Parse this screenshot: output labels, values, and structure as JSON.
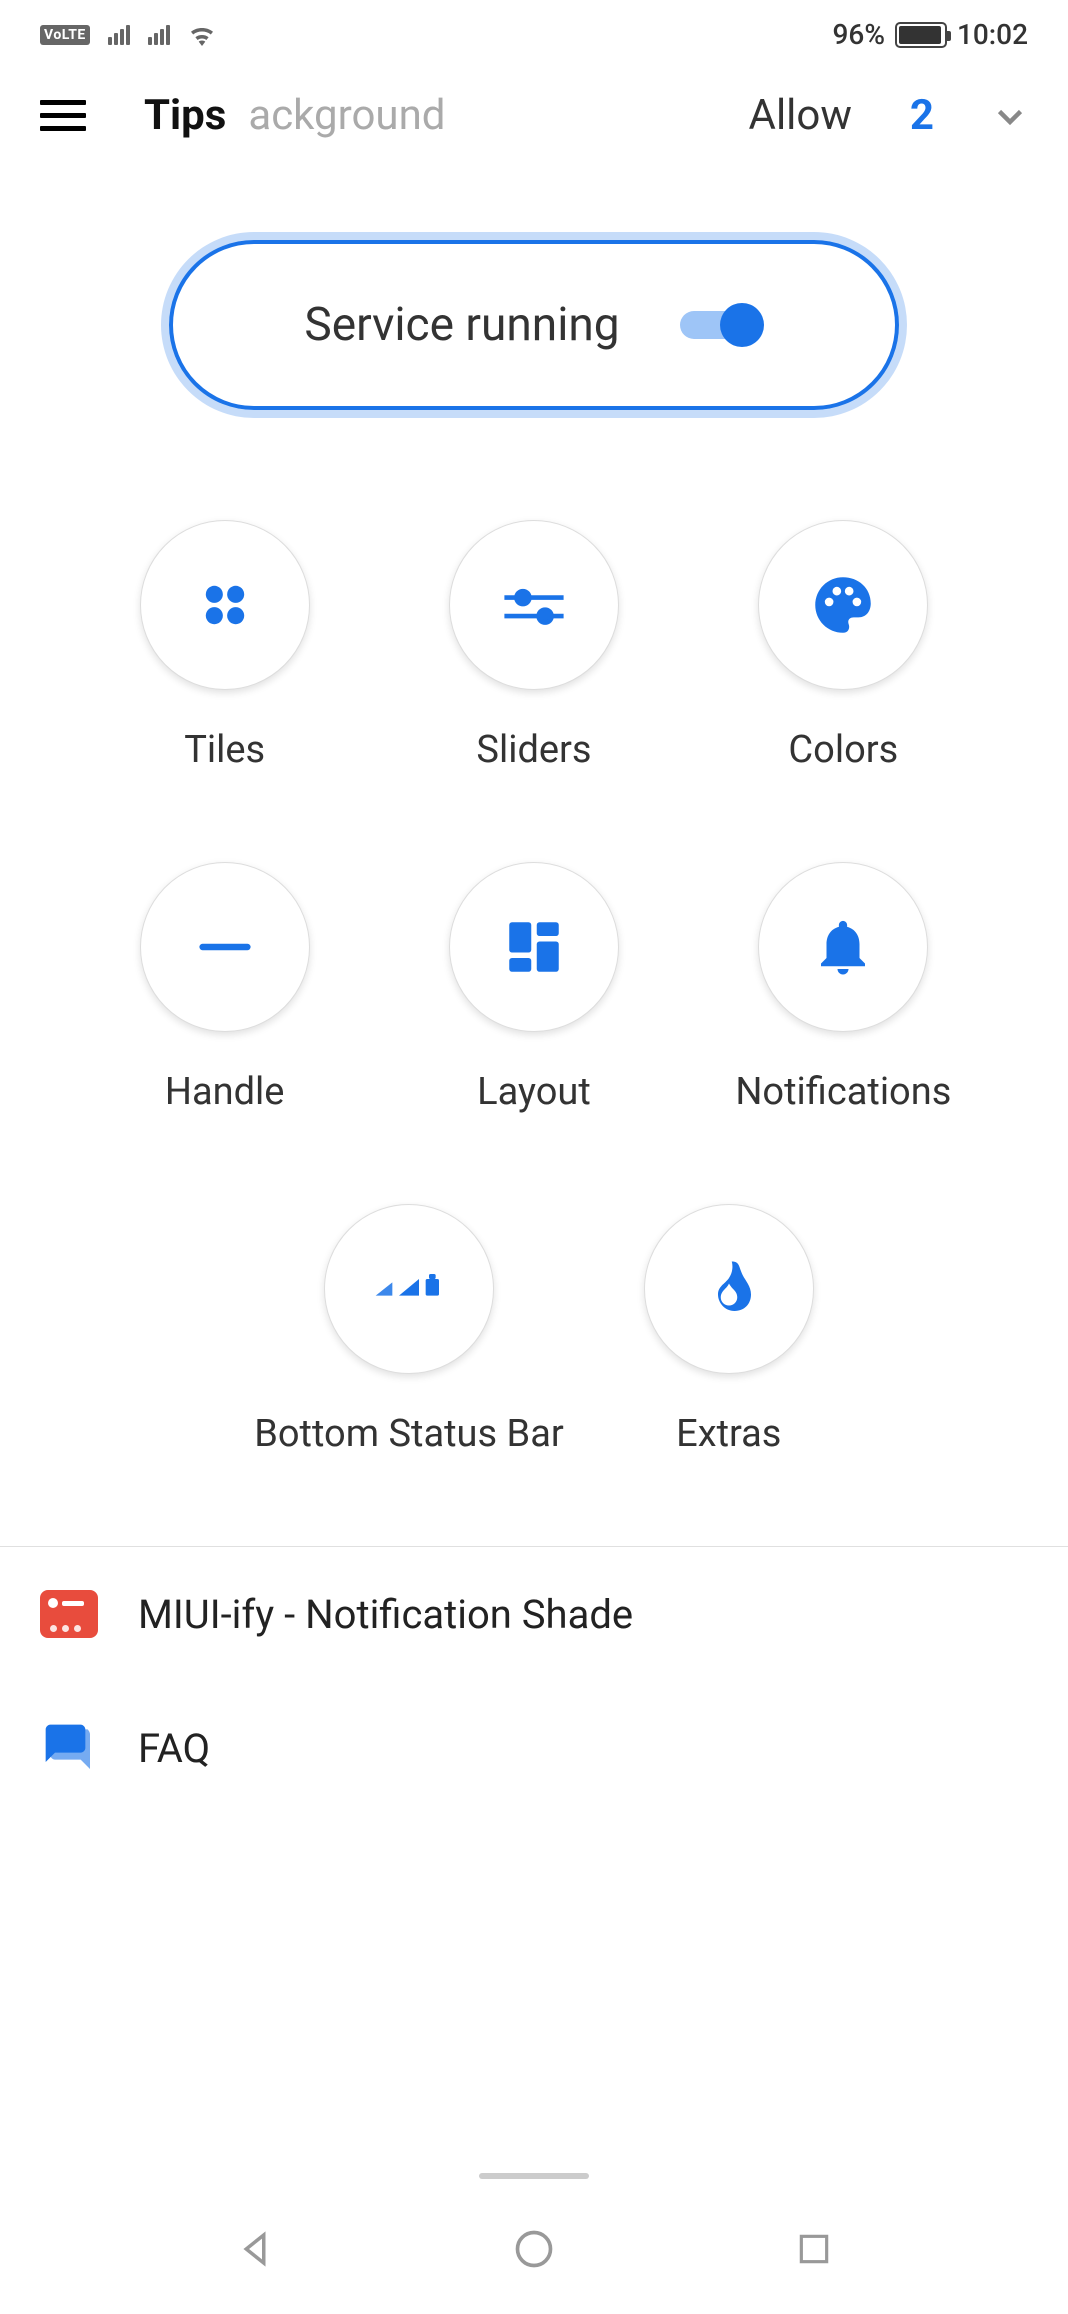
{
  "status_bar": {
    "volte": "VoLTE",
    "battery_percent": "96%",
    "battery_level": 96,
    "time": "10:02"
  },
  "app_bar": {
    "menu": "menu",
    "tips": "Tips",
    "background_partial": "ackground",
    "allow": "Allow",
    "count": "2"
  },
  "service": {
    "label": "Service running",
    "enabled": true,
    "track_color": "#9ec5f7",
    "thumb_color": "#1a73e8"
  },
  "grid": {
    "tiles": "Tiles",
    "sliders": "Sliders",
    "colors": "Colors",
    "handle": "Handle",
    "layout": "Layout",
    "notifications": "Notifications",
    "bottom_status_bar": "Bottom Status Bar",
    "extras": "Extras"
  },
  "list": {
    "miui": "MIUI-ify - Notification Shade",
    "faq": "FAQ"
  },
  "accent": "#1a73e8"
}
